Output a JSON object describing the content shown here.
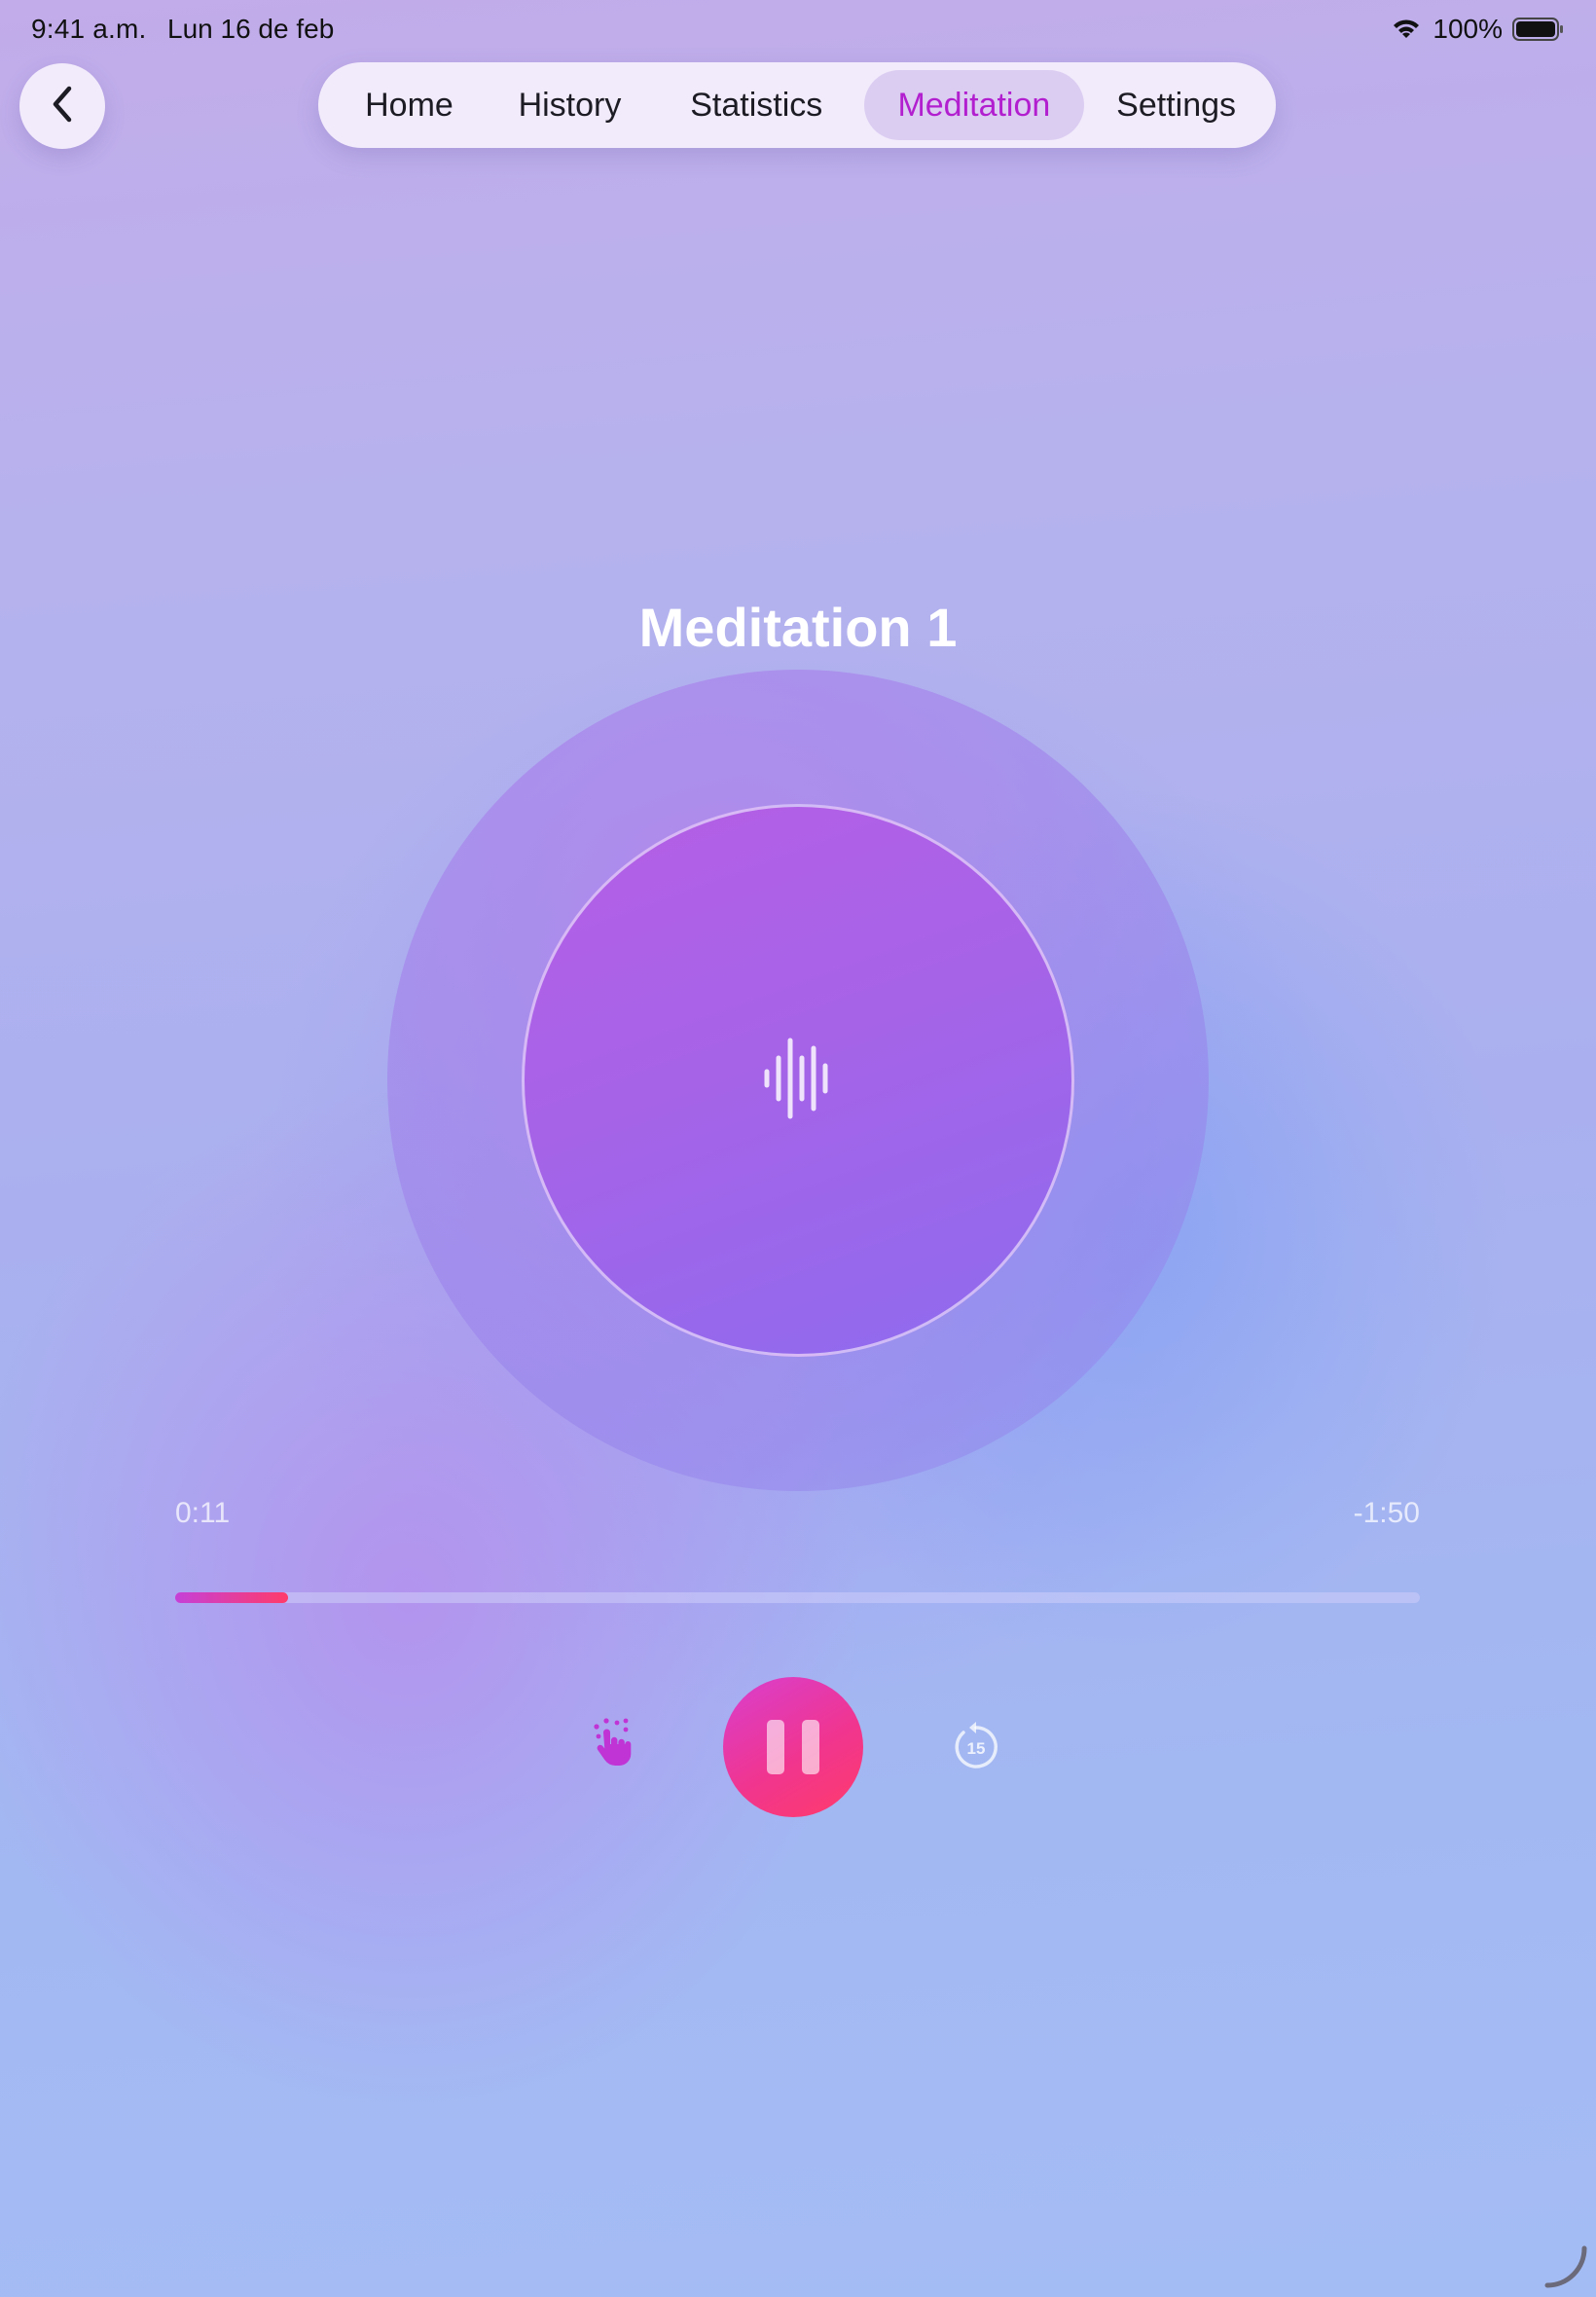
{
  "status_bar": {
    "time": "9:41 a.m.",
    "date": "Lun 16 de feb",
    "battery": "100%"
  },
  "nav": {
    "back_icon": "chevron-left-icon",
    "tabs": [
      {
        "label": "Home",
        "active": false
      },
      {
        "label": "History",
        "active": false
      },
      {
        "label": "Statistics",
        "active": false
      },
      {
        "label": "Meditation",
        "active": true
      },
      {
        "label": "Settings",
        "active": false
      }
    ]
  },
  "player": {
    "title": "Meditation 1",
    "center_icon": "waveform-icon",
    "elapsed": "0:11",
    "remaining": "-1:50",
    "progress_percent": 9.1,
    "controls": {
      "left_icon": "touch-gesture-icon",
      "main_icon": "pause-icon",
      "right_icon": "replay-15-icon",
      "replay_seconds": "15"
    }
  },
  "colors": {
    "accent": "#b21fcf",
    "play_gradient_start": "#d83fd0",
    "play_gradient_end": "#ff3b6a",
    "inner_circle": "#a663e8"
  }
}
